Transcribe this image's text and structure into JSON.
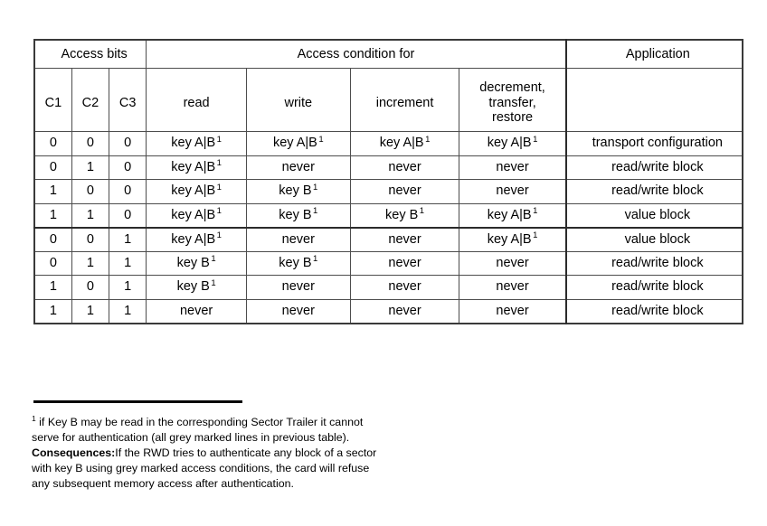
{
  "table": {
    "group_headers": {
      "access_bits": "Access  bits",
      "access_condition_for": "Access   condition   for",
      "application": "Application"
    },
    "columns": {
      "c1": "C1",
      "c2": "C2",
      "c3": "C3",
      "read": "read",
      "write": "write",
      "increment": "increment",
      "decrement": "decrement,\ntransfer,\nrestore",
      "decrement_line1": "decrement,",
      "decrement_line2": "transfer,",
      "decrement_line3": "restore",
      "application": ""
    },
    "footnote_marker": "1",
    "rows": [
      {
        "c1": "0",
        "c2": "0",
        "c3": "0",
        "read": "key A|B",
        "read_sup": "1",
        "write": "key A|B",
        "write_sup": "1",
        "increment": "key A|B",
        "increment_sup": "1",
        "decrement": "key A|B",
        "decrement_sup": "1",
        "application": "transport configuration",
        "grey": true
      },
      {
        "c1": "0",
        "c2": "1",
        "c3": "0",
        "read": "key A|B",
        "read_sup": "1",
        "write": "never",
        "write_sup": "",
        "increment": "never",
        "increment_sup": "",
        "decrement": "never",
        "decrement_sup": "",
        "application": "read/write block",
        "grey": true
      },
      {
        "c1": "1",
        "c2": "0",
        "c3": "0",
        "read": "key A|B",
        "read_sup": "1",
        "write": "key B",
        "write_sup": "1",
        "increment": "never",
        "increment_sup": "",
        "decrement": "never",
        "decrement_sup": "",
        "application": "read/write block",
        "grey": false
      },
      {
        "c1": "1",
        "c2": "1",
        "c3": "0",
        "read": "key A|B",
        "read_sup": "1",
        "write": "key B",
        "write_sup": "1",
        "increment": "key B",
        "increment_sup": "1",
        "decrement": "key A|B",
        "decrement_sup": "1",
        "application": "value block",
        "grey": false
      },
      {
        "c1": "0",
        "c2": "0",
        "c3": "1",
        "read": "key A|B",
        "read_sup": "1",
        "write": "never",
        "write_sup": "",
        "increment": "never",
        "increment_sup": "",
        "decrement": "key A|B",
        "decrement_sup": "1",
        "application": "value block",
        "grey": true
      },
      {
        "c1": "0",
        "c2": "1",
        "c3": "1",
        "read": "key B",
        "read_sup": "1",
        "write": "key B",
        "write_sup": "1",
        "increment": "never",
        "increment_sup": "",
        "decrement": "never",
        "decrement_sup": "",
        "application": "read/write block",
        "grey": false
      },
      {
        "c1": "1",
        "c2": "0",
        "c3": "1",
        "read": "key B",
        "read_sup": "1",
        "write": "never",
        "write_sup": "",
        "increment": "never",
        "increment_sup": "",
        "decrement": "never",
        "decrement_sup": "",
        "application": "read/write block",
        "grey": false
      },
      {
        "c1": "1",
        "c2": "1",
        "c3": "1",
        "read": "never",
        "read_sup": "",
        "write": "never",
        "write_sup": "",
        "increment": "never",
        "increment_sup": "",
        "decrement": "never",
        "decrement_sup": "",
        "application": "read/write block",
        "grey": false
      }
    ]
  },
  "footnote": {
    "marker": "1",
    "part1": " if Key B may be read in the corresponding Sector Trailer it cannot serve for authentication (all grey marked lines in previous table).   ",
    "bold": "Consequences:",
    "part2": "If the RWD tries to authenticate any block of a sector with key B using grey marked access conditions, the card will refuse any subsequent memory access after authentication."
  },
  "colors": {
    "grey_row": "#dedede",
    "border": "#4d4d4d",
    "border_thick": "#2b2b2b",
    "text": "#000000",
    "background": "#ffffff"
  }
}
